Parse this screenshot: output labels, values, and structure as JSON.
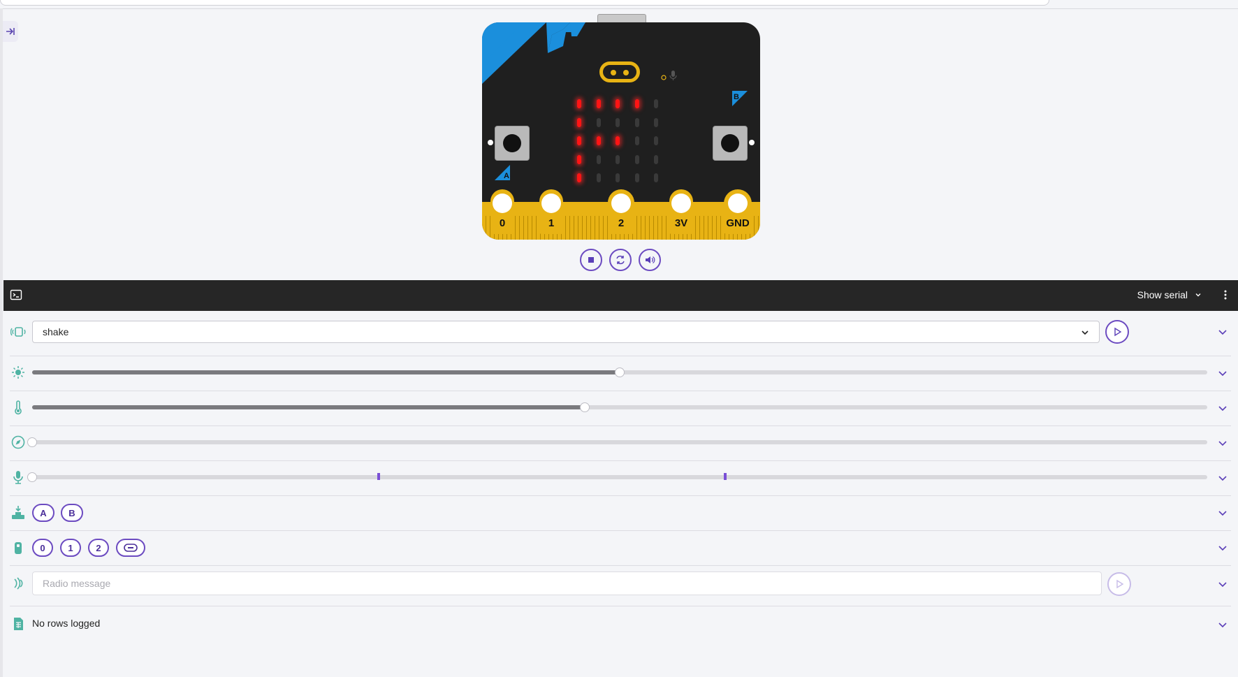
{
  "simulator": {
    "board": {
      "pin_labels": [
        "0",
        "1",
        "2",
        "3V",
        "GND"
      ],
      "button_a_label": "A",
      "button_b_label": "B",
      "led_matrix": [
        [
          1,
          1,
          1,
          1,
          0
        ],
        [
          1,
          0,
          0,
          0,
          0
        ],
        [
          1,
          1,
          1,
          0,
          0
        ],
        [
          1,
          0,
          0,
          0,
          0
        ],
        [
          1,
          0,
          0,
          0,
          0
        ]
      ]
    },
    "controls": [
      {
        "name": "stop",
        "icon": "stop-icon"
      },
      {
        "name": "restart",
        "icon": "restart-icon"
      },
      {
        "name": "sound",
        "icon": "speaker-icon"
      }
    ]
  },
  "serial_bar": {
    "terminal_icon": "terminal-icon",
    "show_serial_label": "Show serial"
  },
  "sensors": {
    "gesture": {
      "icon": "gesture-icon",
      "selected": "shake"
    },
    "light": {
      "icon": "light-icon",
      "level": 0.5
    },
    "temperature": {
      "icon": "thermometer-icon",
      "level": 0.47
    },
    "compass": {
      "icon": "compass-icon",
      "level": 0.0
    },
    "sound": {
      "icon": "microphone-icon",
      "level": 0.0,
      "threshold_marks": [
        0.295,
        0.59
      ]
    },
    "buttons": {
      "icon": "button-press-icon",
      "labels": [
        "A",
        "B"
      ]
    },
    "touch": {
      "icon": "touch-icon",
      "labels": [
        "0",
        "1",
        "2"
      ]
    },
    "radio": {
      "icon": "radio-icon",
      "placeholder": "Radio message"
    },
    "data_logging": {
      "icon": "data-log-icon",
      "status": "No rows logged"
    }
  },
  "colors": {
    "accent": "#6c4bc1",
    "sensor_icon": "#4fb3a3",
    "dark_bar": "#262626",
    "led_on": "#ff1414",
    "board_gold": "#e8b314",
    "board_blue": "#1b8fdc"
  }
}
